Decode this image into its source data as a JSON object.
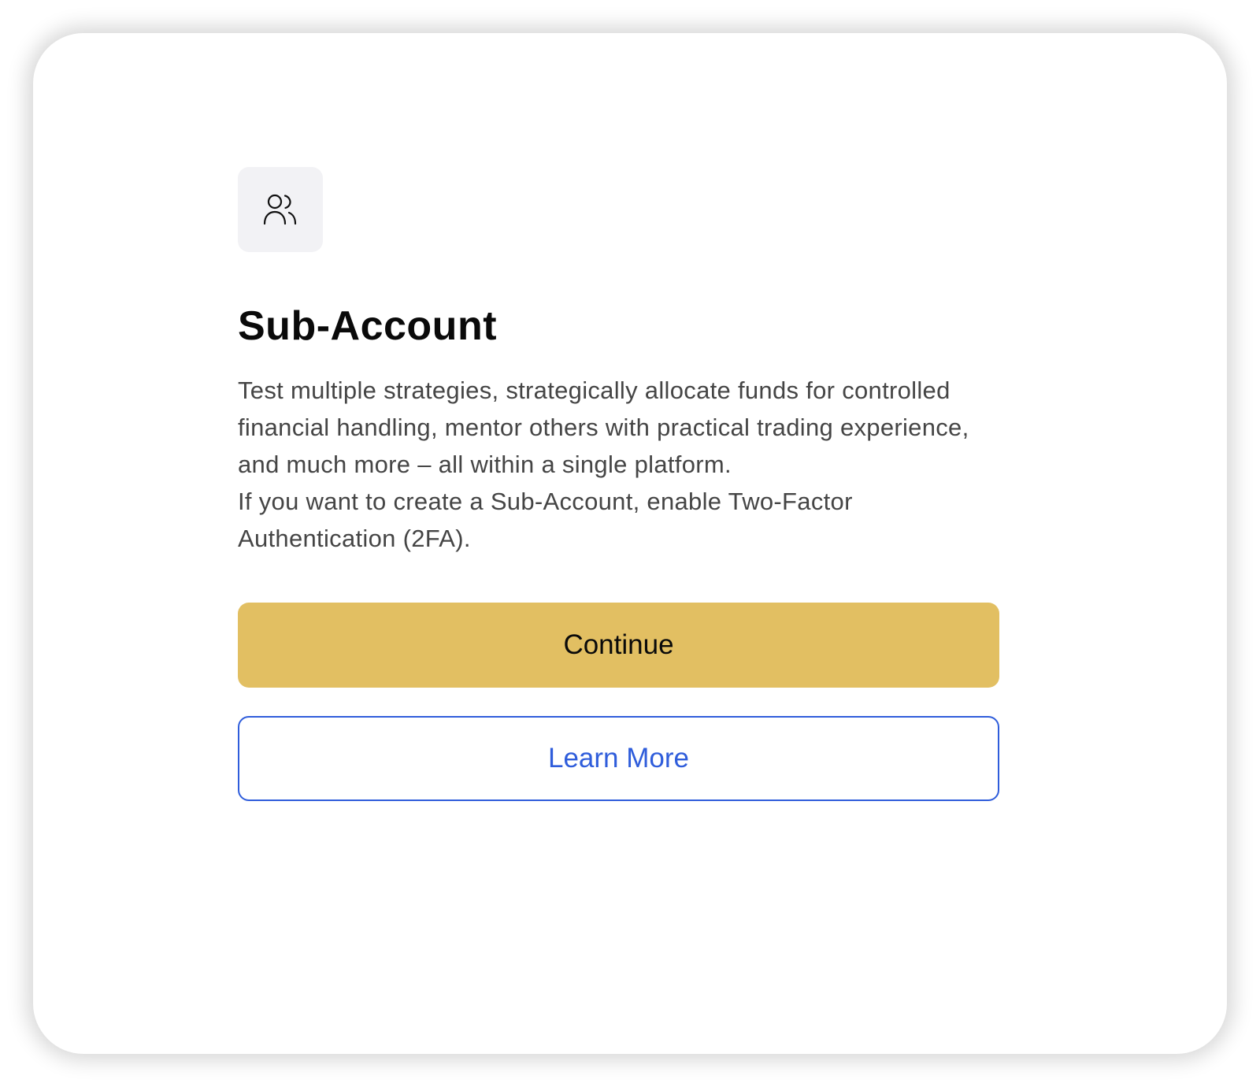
{
  "dialog": {
    "icon": "users-icon",
    "title": "Sub-Account",
    "description_lines": [
      "Test multiple strategies, strategically allocate funds for controlled financial handling, mentor others with practical trading experience, and much more – all within a single platform.",
      "If you want to create a Sub-Account, enable Two-Factor Authentication (2FA)."
    ],
    "continue_label": "Continue",
    "learn_more_label": "Learn More"
  },
  "colors": {
    "primary_button": "#e2bf62",
    "secondary_accent": "#2f5ddb",
    "icon_background": "#f2f2f5"
  }
}
